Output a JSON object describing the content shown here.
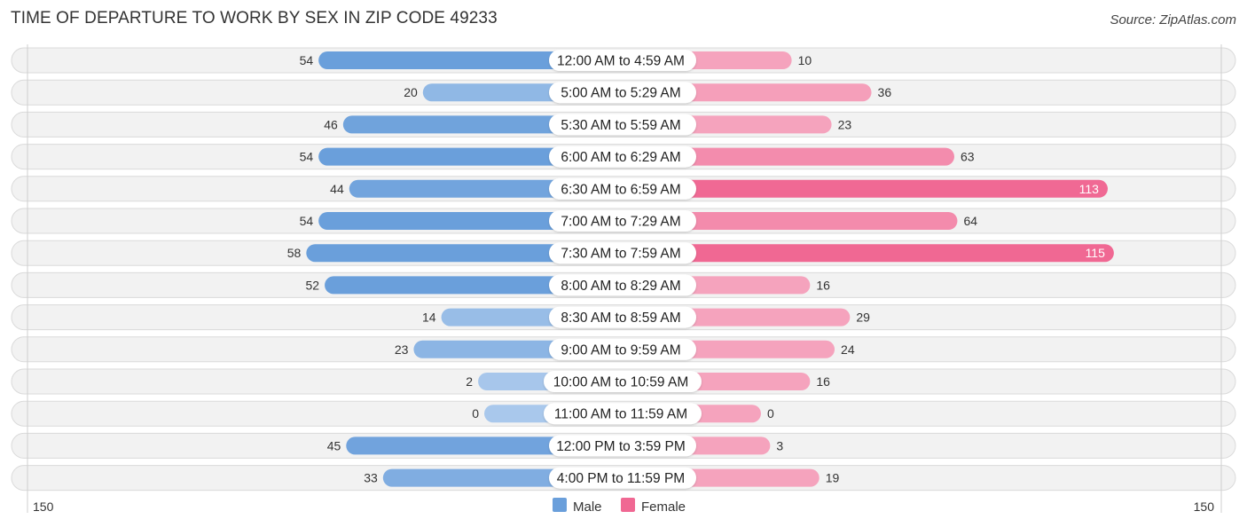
{
  "header": {
    "title": "TIME OF DEPARTURE TO WORK BY SEX IN ZIP CODE 49233",
    "source": "Source: ZipAtlas.com"
  },
  "colors": {
    "male": "#6a9fdb",
    "male_light": "#a9c8ec",
    "female": "#f06893",
    "female_light": "#f5a3bd"
  },
  "chart_data": {
    "type": "bar",
    "orientation": "horizontal-diverging",
    "title": "TIME OF DEPARTURE TO WORK BY SEX IN ZIP CODE 49233",
    "categories": [
      "12:00 AM to 4:59 AM",
      "5:00 AM to 5:29 AM",
      "5:30 AM to 5:59 AM",
      "6:00 AM to 6:29 AM",
      "6:30 AM to 6:59 AM",
      "7:00 AM to 7:29 AM",
      "7:30 AM to 7:59 AM",
      "8:00 AM to 8:29 AM",
      "8:30 AM to 8:59 AM",
      "9:00 AM to 9:59 AM",
      "10:00 AM to 10:59 AM",
      "11:00 AM to 11:59 AM",
      "12:00 PM to 3:59 PM",
      "4:00 PM to 11:59 PM"
    ],
    "series": [
      {
        "name": "Male",
        "values": [
          54,
          20,
          46,
          54,
          44,
          54,
          58,
          52,
          14,
          23,
          2,
          0,
          45,
          33
        ]
      },
      {
        "name": "Female",
        "values": [
          10,
          36,
          23,
          63,
          113,
          64,
          115,
          16,
          29,
          24,
          16,
          0,
          3,
          19
        ]
      }
    ],
    "axis": {
      "left_label": "150",
      "right_label": "150",
      "range": [
        -150,
        150
      ]
    },
    "legend": {
      "entries": [
        "Male",
        "Female"
      ],
      "placement": "bottom-center"
    },
    "grid": false
  }
}
